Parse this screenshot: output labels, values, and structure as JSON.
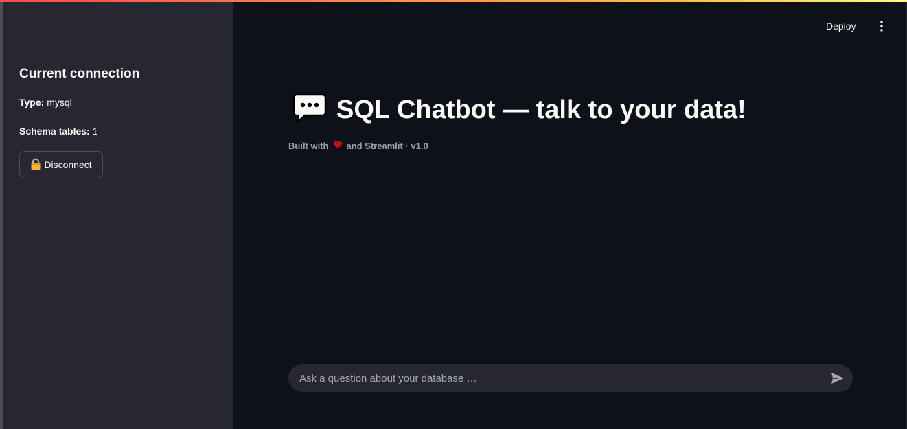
{
  "sidebar": {
    "heading": "Current connection",
    "type_label": "Type:",
    "type_value": "mysql",
    "schema_label": "Schema tables:",
    "schema_value": "1",
    "disconnect_icon": "lock-icon",
    "disconnect_label": "Disconnect"
  },
  "header": {
    "deploy_label": "Deploy",
    "menu_icon": "more-vertical-icon"
  },
  "main": {
    "title_icon": "speech-bubble-icon",
    "title": "SQL Chatbot — talk to your data!",
    "caption_prefix": "Built with",
    "caption_icon": "heart-icon",
    "caption_suffix": "and Streamlit · v1.0"
  },
  "chat": {
    "placeholder": "Ask a question about your database …",
    "value": "",
    "send_icon": "send-icon"
  },
  "colors": {
    "background": "#0e1117",
    "sidebar_background": "#262730",
    "text": "#fafafa",
    "muted_text": "#9ca0a8",
    "heart": "#b5121b",
    "lock": "#f5b731",
    "accent_gradient_start": "#ff4b4b",
    "accent_gradient_end": "#fffd80"
  }
}
